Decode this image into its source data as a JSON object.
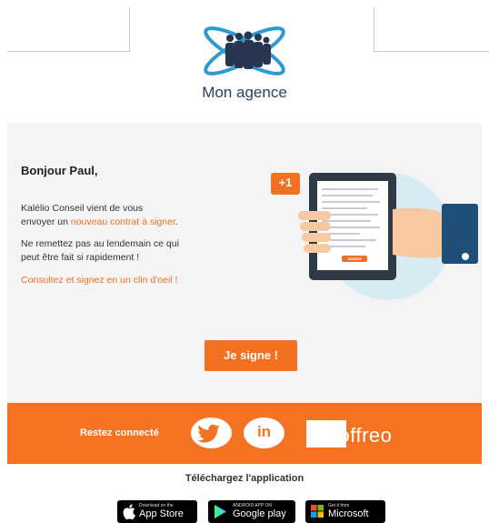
{
  "header": {
    "agency_name": "Mon agence"
  },
  "message": {
    "greeting": "Bonjour Paul,",
    "line1_prefix": "Kalélio Conseil vient de vous",
    "line2_prefix": "envoyer un ",
    "line2_highlight": "nouveau contrat à signer",
    "line2_suffix": ".",
    "line3": "Ne remettez pas au lendemain ce qui",
    "line4": "peut être fait si rapidement !",
    "line5": "Consultez et signez en un clin d'oeil !"
  },
  "illustration": {
    "badge": "+1",
    "tablet_button": "SIGNER"
  },
  "cta": {
    "label": "Je signe !"
  },
  "footer": {
    "stay_connected": "Restez connecté",
    "linkedin_label": "in",
    "brand": "coffreo"
  },
  "download": {
    "title": "Téléchargez l'application",
    "stores": [
      {
        "small": "Download on the",
        "big": "App Store"
      },
      {
        "small": "ANDROID APP ON",
        "big": "Google play"
      },
      {
        "small": "Get it from",
        "big": "Microsoft"
      }
    ]
  },
  "colors": {
    "accent": "#f37021",
    "navy": "#2a3f66",
    "panel": "#f4f4f4"
  }
}
